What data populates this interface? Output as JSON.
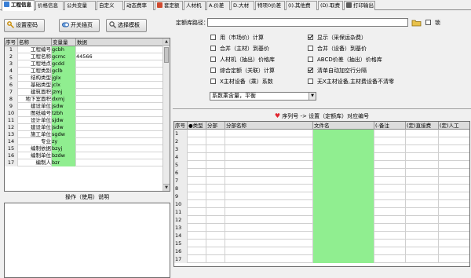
{
  "tabs": [
    {
      "label": "工程信息",
      "icon": "project-icon",
      "color": "#3a7fd5"
    },
    {
      "label": "价格信息",
      "icon": "",
      "color": ""
    },
    {
      "label": "公共变量",
      "icon": "",
      "color": ""
    },
    {
      "label": "自定义",
      "icon": "",
      "color": ""
    },
    {
      "label": "动态费率",
      "icon": "",
      "color": ""
    },
    {
      "label": "套定额",
      "icon": "quota-icon",
      "color": "#d04a2f"
    },
    {
      "label": "人材机",
      "icon": "",
      "color": ""
    },
    {
      "label": "A.价差",
      "icon": "",
      "color": ""
    },
    {
      "label": "D.大材",
      "icon": "",
      "color": ""
    },
    {
      "label": "特项0价差",
      "icon": "",
      "color": ""
    },
    {
      "label": "(I).其他费",
      "icon": "",
      "color": ""
    },
    {
      "label": "(D).取费",
      "icon": "",
      "color": ""
    },
    {
      "label": "打印输出",
      "icon": "print-icon",
      "color": "#5b5b5b"
    }
  ],
  "left": {
    "buttons": [
      {
        "label": "设置密码",
        "icon": "key-icon"
      },
      {
        "label": "开关插页",
        "icon": "switch-icon"
      },
      {
        "label": "选择模板",
        "icon": "template-icon"
      }
    ],
    "grid": {
      "headers": [
        "序号",
        "名称",
        "变量量",
        "数据"
      ],
      "rows": [
        {
          "no": "1",
          "name": "工程编号",
          "var": "gcbh",
          "data": ""
        },
        {
          "no": "2",
          "name": "工程名称",
          "var": "gcmc",
          "data": "44566"
        },
        {
          "no": "3",
          "name": "工程地点",
          "var": "gcdd",
          "data": ""
        },
        {
          "no": "4",
          "name": "工程类别",
          "var": "gclb",
          "data": ""
        },
        {
          "no": "5",
          "name": "结构类型",
          "var": "jglx",
          "data": ""
        },
        {
          "no": "6",
          "name": "基础类型",
          "var": "jclx",
          "data": ""
        },
        {
          "no": "7",
          "name": "建筑面积",
          "var": "jzmj",
          "data": ""
        },
        {
          "no": "8",
          "name": "地下室面积",
          "var": "dxmj",
          "data": ""
        },
        {
          "no": "9",
          "name": "建设单位",
          "var": "jsdw",
          "data": ""
        },
        {
          "no": "10",
          "name": "图纸编号",
          "var": "tzbh",
          "data": ""
        },
        {
          "no": "11",
          "name": "设计单位",
          "var": "sjdw",
          "data": ""
        },
        {
          "no": "12",
          "name": "建设单位",
          "var": "jsdw",
          "data": ""
        },
        {
          "no": "13",
          "name": "施工单位",
          "var": "sgdw",
          "data": ""
        },
        {
          "no": "14",
          "name": "专业",
          "var": "zy",
          "data": ""
        },
        {
          "no": "15",
          "name": "编制依据",
          "var": "bzyj",
          "data": ""
        },
        {
          "no": "16",
          "name": "编制单位",
          "var": "bzdw",
          "data": ""
        },
        {
          "no": "17",
          "name": "编制人",
          "var": "bzr",
          "data": ""
        }
      ]
    },
    "ops_label": "操作（使用）说明"
  },
  "right": {
    "path_label": "定额库路径：",
    "lock_label": "锁",
    "checks": [
      {
        "label": "用（市场价）计算",
        "on": false
      },
      {
        "label": "显示（采保运杂费）",
        "on": true
      },
      {
        "label": "合并（主材）到基价",
        "on": false
      },
      {
        "label": "合并（设备）到基价",
        "on": false
      },
      {
        "label": "人材机（抽出）价格库",
        "on": false
      },
      {
        "label": "ABCD价差（抽出）价格库",
        "on": false
      },
      {
        "label": "综合定额（关联）计算",
        "on": false
      },
      {
        "label": "清单自动加空行分隔",
        "on": true
      },
      {
        "label": "X主材设备（乘）系数",
        "on": false
      },
      {
        "label": "无X主材设备,主材费设备不清零",
        "on": false
      }
    ],
    "combo_value": "系数乘含量，平衡",
    "section_title": "序列号 -> 设置（定额库）对应编号",
    "grid_headers": [
      "序号",
      "●类型",
      "分部",
      "分部名称",
      "文件名",
      "(-备注",
      "(定)直接费",
      "(定)人工"
    ],
    "row_numbers": [
      "1",
      "2",
      "3",
      "4",
      "5",
      "6",
      "7",
      "8",
      "9",
      "10",
      "11",
      "12",
      "13",
      "14",
      "15",
      "16",
      "17"
    ]
  },
  "colors": {
    "cell_green": "#90ee90",
    "heart": "#e0242e"
  }
}
